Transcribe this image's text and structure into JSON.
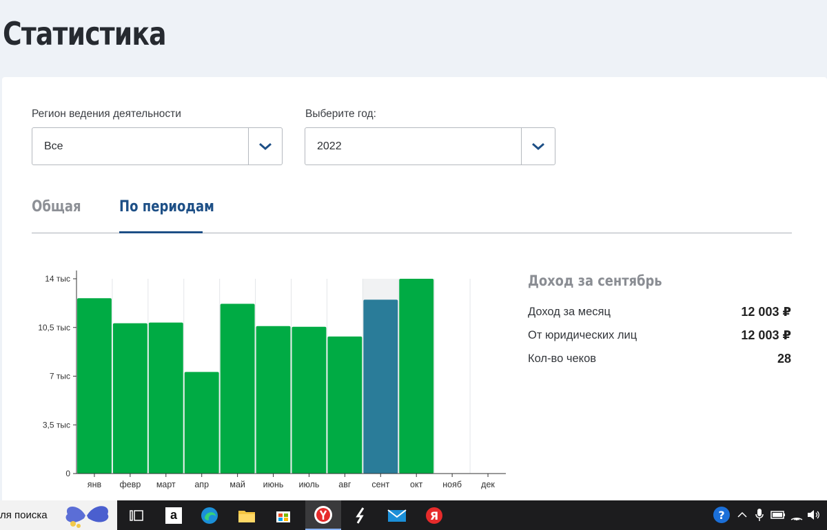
{
  "page": {
    "title": "Статистика"
  },
  "filters": {
    "region": {
      "label": "Регион ведения деятельности",
      "value": "Все"
    },
    "year": {
      "label": "Выберите год:",
      "value": "2022"
    }
  },
  "tabs": [
    {
      "label": "Общая",
      "active": false
    },
    {
      "label": "По периодам",
      "active": true
    }
  ],
  "summary": {
    "title": "Доход за сентябрь",
    "rows": [
      {
        "label": "Доход за месяц",
        "value": "12 003 ₽"
      },
      {
        "label": "От юридических лиц",
        "value": "12 003 ₽"
      },
      {
        "label": "Кол-во чеков",
        "value": "28"
      }
    ]
  },
  "chart_data": {
    "type": "bar",
    "categories": [
      "янв",
      "февр",
      "март",
      "апр",
      "май",
      "июнь",
      "июль",
      "авг",
      "сент",
      "окт",
      "нояб",
      "дек"
    ],
    "values": [
      12600,
      10800,
      10850,
      7300,
      12200,
      10600,
      10550,
      9850,
      12500,
      14000,
      null,
      null
    ],
    "yticks": [
      "0",
      "3,5 тыс",
      "7 тыс",
      "10,5 тыс",
      "14 тыс"
    ],
    "ylim": [
      0,
      14000
    ],
    "selected_category": "сент",
    "colors": {
      "bar": "#00ab44",
      "selected": "#2a7c99",
      "selected_column_bg": "#f1f2f3",
      "grid": "#e3e5e8"
    }
  },
  "taskbar": {
    "search_text": "ля поиска",
    "apps": [
      "task-view-icon",
      "amazon-icon",
      "edge-icon",
      "file-explorer-icon",
      "store-icon",
      "yandex-browser-icon",
      "app-s-icon",
      "mail-icon",
      "yandex-icon"
    ]
  }
}
